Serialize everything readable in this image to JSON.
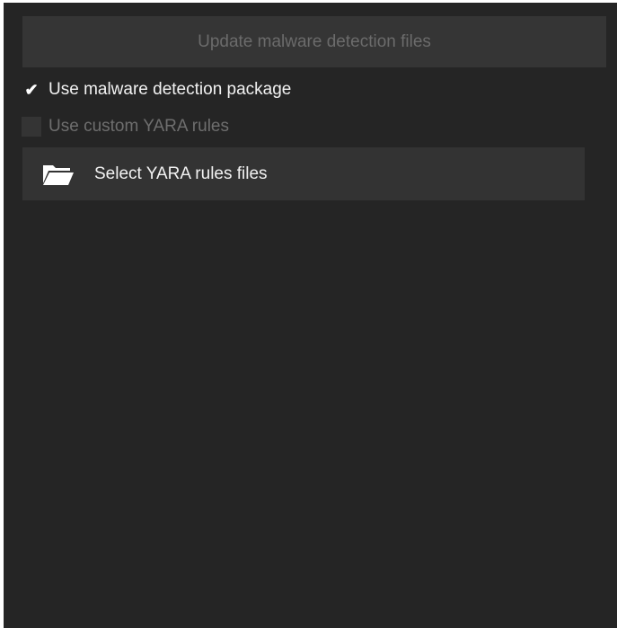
{
  "update_button": {
    "label": "Update malware detection files",
    "enabled": false
  },
  "options": {
    "malware_package": {
      "label": "Use malware detection package",
      "checked": true
    },
    "custom_yara": {
      "label": "Use custom YARA rules",
      "checked": false,
      "enabled": false
    }
  },
  "select_button": {
    "label": "Select YARA rules files",
    "icon": "folder-open-icon"
  },
  "colors": {
    "panel_bg": "#252525",
    "button_bg": "#333333",
    "text": "#f2f2f2",
    "disabled_text": "#6e6e6e"
  }
}
